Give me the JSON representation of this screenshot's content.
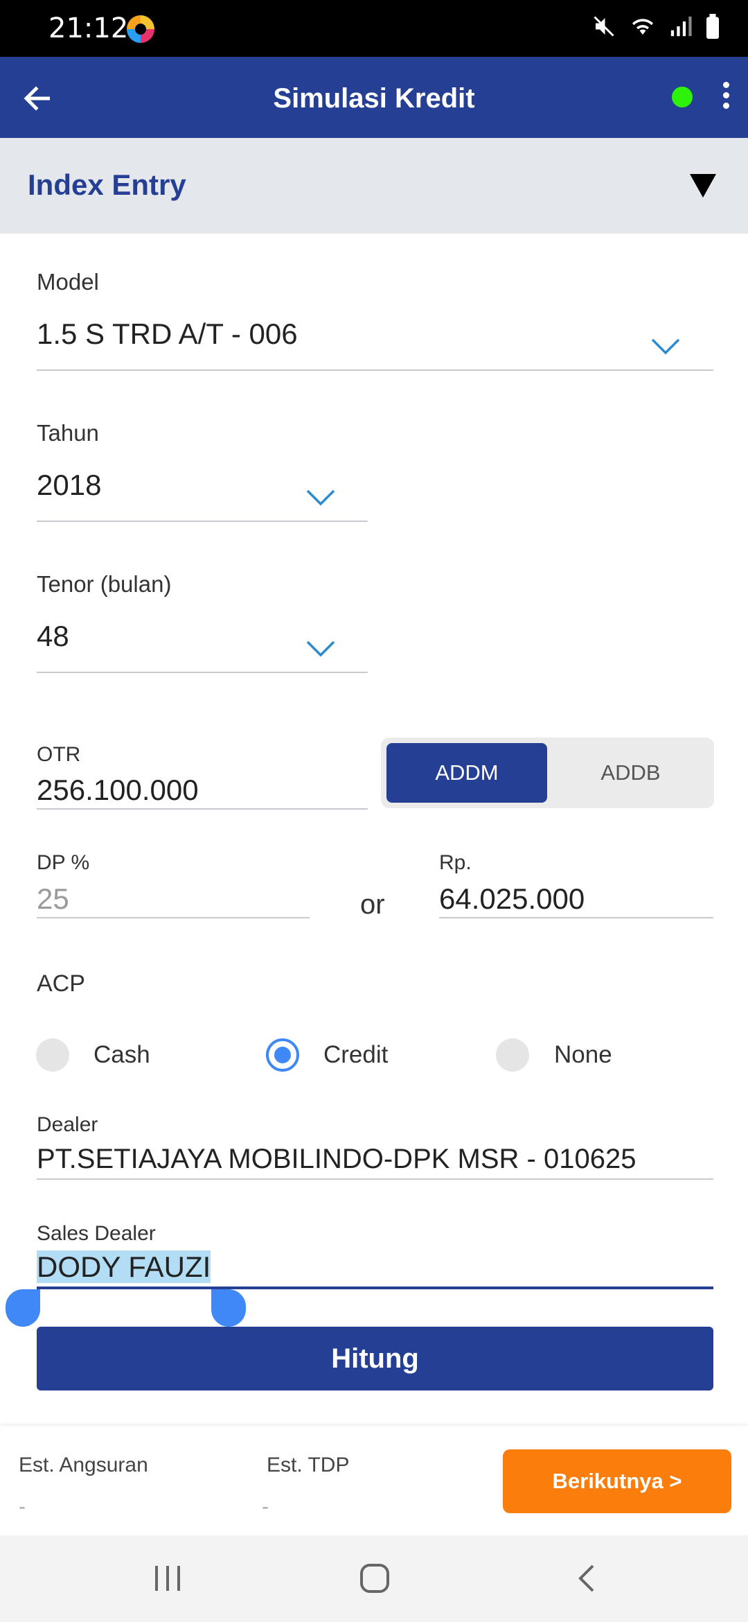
{
  "status_bar": {
    "time": "21:12"
  },
  "app_bar": {
    "title": "Simulasi Kredit"
  },
  "section": {
    "title": "Index Entry"
  },
  "form": {
    "model": {
      "label": "Model",
      "value": "1.5 S TRD A/T - 006"
    },
    "tahun": {
      "label": "Tahun",
      "value": "2018"
    },
    "tenor": {
      "label": "Tenor (bulan)",
      "value": "48"
    },
    "otr": {
      "label": "OTR",
      "value": "256.100.000"
    },
    "toggle": {
      "option_a": "ADDM",
      "option_b": "ADDB",
      "selected": "ADDM"
    },
    "dp_percent": {
      "label": "DP %",
      "placeholder": "25"
    },
    "or_text": "or",
    "dp_rp": {
      "label": "Rp.",
      "value": "64.025.000"
    },
    "acp": {
      "label": "ACP",
      "options": [
        "Cash",
        "Credit",
        "None"
      ],
      "selected": "Credit"
    },
    "dealer": {
      "label": "Dealer",
      "value": "PT.SETIAJAYA MOBILINDO-DPK MSR - 010625"
    },
    "sales_dealer": {
      "label": "Sales Dealer",
      "value": "DODY FAUZI"
    },
    "calculate_button": "Hitung"
  },
  "summary": {
    "angsuran_label": "Est. Angsuran",
    "angsuran_value": "-",
    "tdp_label": "Est. TDP",
    "tdp_value": "-",
    "next_button": "Berikutnya >"
  },
  "colors": {
    "primary": "#253f94",
    "accent_orange": "#fb7e0d",
    "online_dot": "#2df20a",
    "radio_selected": "#3f88f5"
  }
}
